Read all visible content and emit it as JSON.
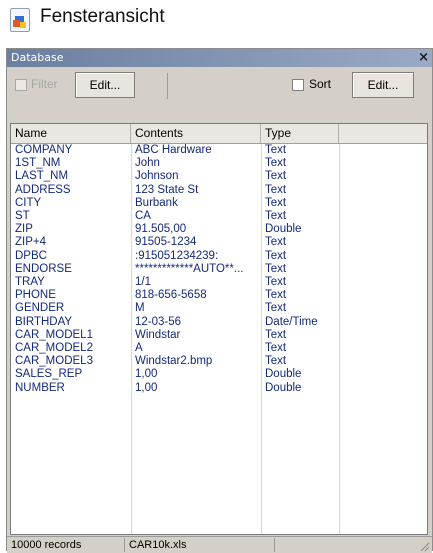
{
  "caption": {
    "title": "Fensteransicht"
  },
  "window": {
    "title": "Database",
    "close_glyph": "×"
  },
  "toolbar": {
    "filter_label": "Filter",
    "edit_left_label": "Edit...",
    "sort_label": "Sort",
    "edit_right_label": "Edit..."
  },
  "table": {
    "headers": [
      "Name",
      "Contents",
      "Type"
    ],
    "rows": [
      [
        "COMPANY",
        "ABC Hardware",
        "Text"
      ],
      [
        "1ST_NM",
        "John",
        "Text"
      ],
      [
        "LAST_NM",
        "Johnson",
        "Text"
      ],
      [
        "ADDRESS",
        "123 State St",
        "Text"
      ],
      [
        "CITY",
        "Burbank",
        "Text"
      ],
      [
        "ST",
        "CA",
        "Text"
      ],
      [
        "ZIP",
        "91.505,00",
        "Double"
      ],
      [
        "ZIP+4",
        "91505-1234",
        "Text"
      ],
      [
        "DPBC",
        ":915051234239:",
        "Text"
      ],
      [
        "ENDORSE",
        "*************AUTO**...",
        "Text"
      ],
      [
        "TRAY",
        "1/1",
        "Text"
      ],
      [
        "PHONE",
        "818-656-5658",
        "Text"
      ],
      [
        "GENDER",
        "M",
        "Text"
      ],
      [
        "BIRTHDAY",
        "12-03-56",
        "Date/Time"
      ],
      [
        "CAR_MODEL1",
        "Windstar",
        "Text"
      ],
      [
        "CAR_MODEL2",
        "A",
        "Text"
      ],
      [
        "CAR_MODEL3",
        "Windstar2.bmp",
        "Text"
      ],
      [
        "SALES_REP",
        "1,00",
        "Double"
      ],
      [
        "NUMBER",
        "1,00",
        "Double"
      ]
    ]
  },
  "status": {
    "records": "10000 records",
    "file": "CAR10k.xls"
  }
}
